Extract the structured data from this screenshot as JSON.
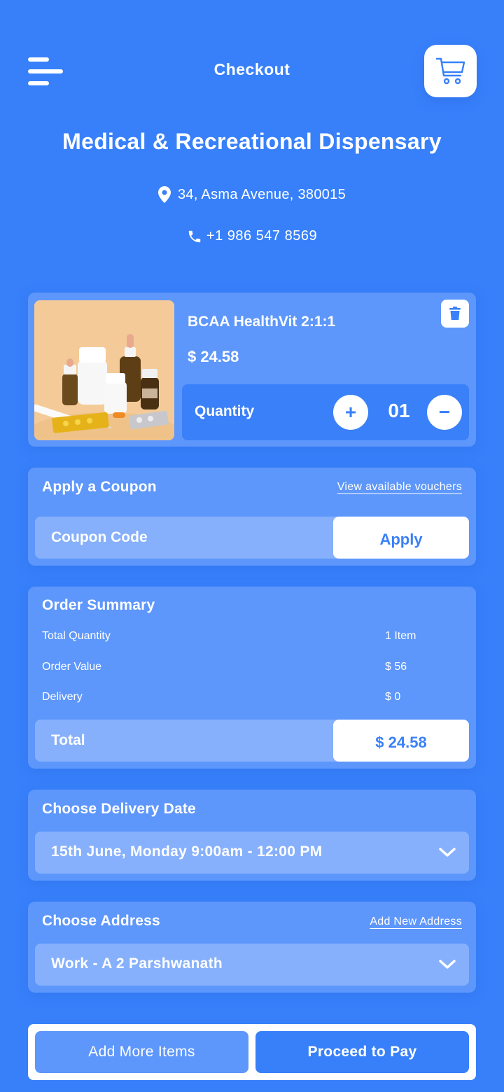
{
  "header": {
    "title": "Checkout",
    "menu_icon": "hamburger-menu-icon",
    "cart_icon": "shopping-cart-icon"
  },
  "store": {
    "name": "Medical & Recreational Dispensary",
    "address": "34, Asma Avenue, 380015",
    "phone": "+1 986 547 8569",
    "address_icon": "location-pin-icon",
    "phone_icon": "phone-icon"
  },
  "product": {
    "name": "BCAA HealthVit 2:1:1",
    "price": "$ 24.58",
    "quantity_label": "Quantity",
    "quantity": "01",
    "plus_label": "+",
    "minus_label": "−",
    "image_alt": "medicine bottles and pills"
  },
  "coupon": {
    "title": "Apply a Coupon",
    "link": "View available vouchers",
    "placeholder": "Coupon Code",
    "value": "",
    "apply_label": "Apply"
  },
  "summary": {
    "title": "Order Summary",
    "rows": [
      {
        "label": "Total Quantity",
        "value": "1 Item"
      },
      {
        "label": "Order Value",
        "value": "$ 56"
      },
      {
        "label": "Delivery",
        "value": "$ 0"
      }
    ],
    "total_label": "Total",
    "total_value": "$ 24.58"
  },
  "delivery": {
    "title": "Choose Delivery Date",
    "selected": "15th June, Monday 9:00am - 12:00 PM"
  },
  "address": {
    "title": "Choose Address",
    "link": "Add New Address",
    "selected": "Work - A 2 Parshwanath"
  },
  "actions": {
    "add_more": "Add More Items",
    "proceed": "Proceed to Pay"
  },
  "colors": {
    "background": "#3880fa",
    "card": "#5e97fb",
    "input": "#86b0fb",
    "accent": "#3a80f8",
    "white": "#ffffff"
  }
}
